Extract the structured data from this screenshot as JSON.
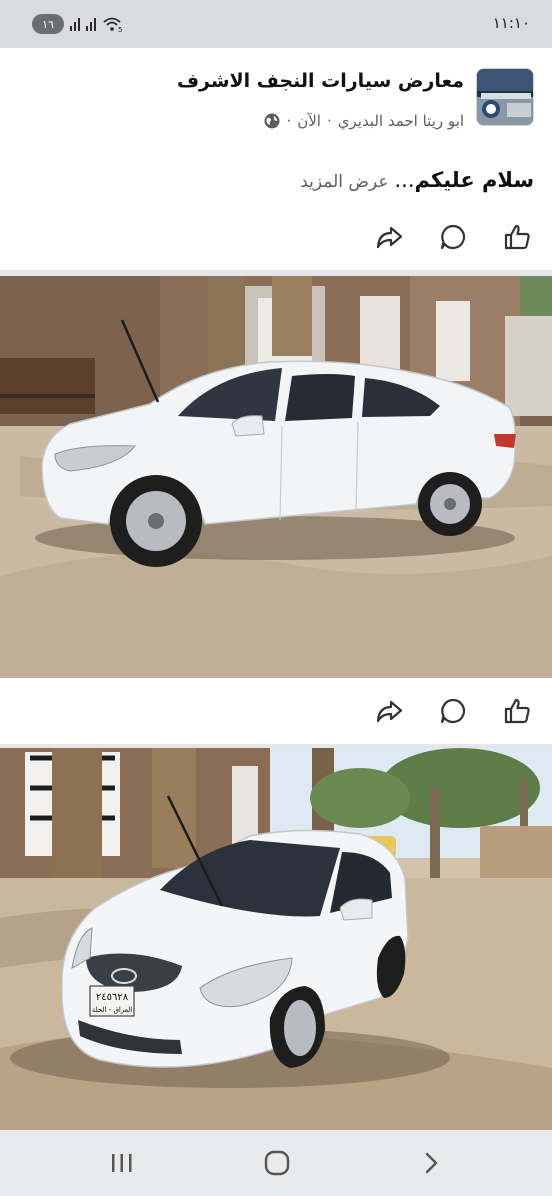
{
  "status_bar": {
    "time": "١١:١٠",
    "battery": "١٦",
    "wifi_label": "5"
  },
  "post": {
    "page_name": "معارض سيارات النجف الاشرف",
    "author": "ابو ريتا احمد البديري",
    "time": "الآن",
    "separator": "·",
    "text": "سلام عليكم",
    "ellipsis": "...",
    "see_more": "عرض المزيد"
  },
  "photo2": {
    "plate_number": "٢٤٥٦٢٨",
    "plate_region": "العراق - الحلة"
  },
  "icons": {
    "share": "share-icon",
    "comment": "comment-icon",
    "like": "like-icon",
    "globe": "globe-icon"
  },
  "colors": {
    "background": "#e4e6e9",
    "card": "#ffffff",
    "text_primary": "#111111",
    "text_secondary": "#5a5e63"
  }
}
